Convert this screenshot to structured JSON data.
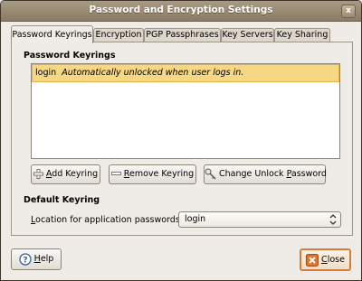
{
  "window": {
    "title": "Password and Encryption Settings",
    "close_glyph": "x"
  },
  "tabs": [
    {
      "label": "Password Keyrings",
      "active": true
    },
    {
      "label": "Encryption"
    },
    {
      "label": "PGP Passphrases"
    },
    {
      "label": "Key Servers"
    },
    {
      "label": "Key Sharing"
    }
  ],
  "keyrings": {
    "heading": "Password Keyrings",
    "items": [
      {
        "name": "login",
        "status": "Automatically unlocked when user logs in."
      }
    ]
  },
  "actions": {
    "add": {
      "mnemonic": "A",
      "rest": "dd Keyring",
      "icon": "add-icon"
    },
    "remove": {
      "mnemonic": "R",
      "rest": "emove Keyring",
      "icon": "remove-icon"
    },
    "change": {
      "prefix": "Change Unlock ",
      "mnemonic": "P",
      "rest": "assword",
      "icon": "keys-icon"
    }
  },
  "default_keyring": {
    "heading": "Default Keyring",
    "location_mnemonic": "L",
    "location_rest": "ocation for application passwords:",
    "value": "login"
  },
  "footer": {
    "help": {
      "mnemonic": "H",
      "rest": "elp",
      "icon": "help-icon"
    },
    "close": {
      "mnemonic": "C",
      "rest": "lose",
      "icon": "close-icon"
    }
  },
  "colors": {
    "selection": "#f6d783",
    "titlebar": "#9a8a72",
    "close_accent": "#d47d3c"
  }
}
